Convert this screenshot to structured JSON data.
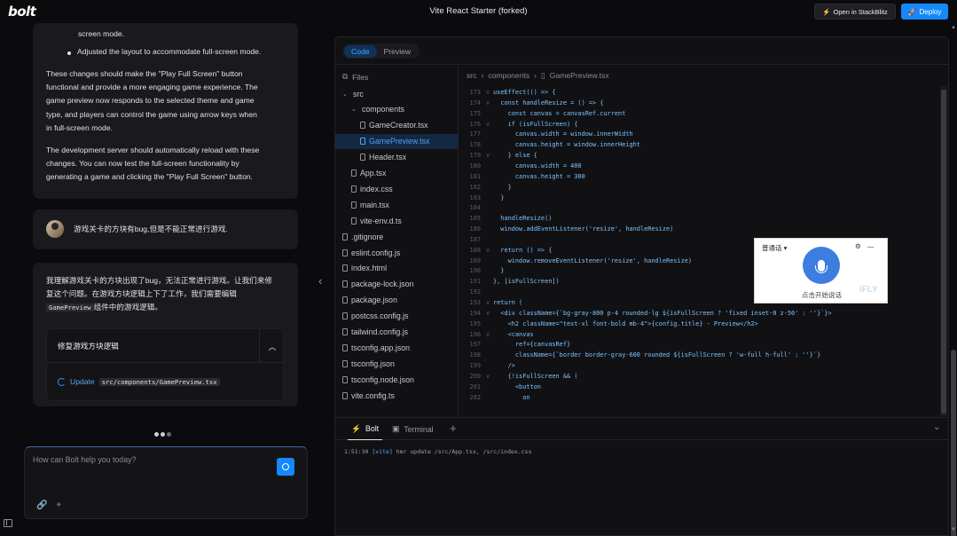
{
  "topbar": {
    "logo": "bolt",
    "title": "Vite React Starter (forked)",
    "stackblitz_label": "Open in StackBlitz",
    "deploy_label": "Deploy"
  },
  "chat": {
    "first_card": {
      "bullet_0_tail": "screen mode.",
      "bullet_1": "Adjusted the layout to accommodate full-screen mode.",
      "para_1": [
        "These changes should make the \"Play Full Screen\" button",
        "functional and provide a more engaging game experience. The",
        "game preview now responds to the selected theme and game",
        "type, and players can control the game using arrow keys when",
        "in full-screen mode."
      ],
      "para_2": [
        "The development server should automatically reload with these",
        "changes. You can now test the full-screen functionality by",
        "generating a game and clicking the \"Play Full Screen\" button."
      ]
    },
    "user_message": "游戏关卡的方块有bug,但是不能正常进行游戏.",
    "reply": {
      "line_1": "我理解游戏关卡的方块出现了bug，无法正常进行游戏。让我们来修",
      "line_2": "复这个问题。在游戏方块逻辑上下了工作，我们需要编辑",
      "code_ref": "GamePreview",
      "line_3_tail": "组件中的游戏逻辑。"
    },
    "action": {
      "title": "修复游戏方块逻辑",
      "verb": "Update",
      "path": "src/components/GamePreview.tsx"
    },
    "input_placeholder": "How can Bolt help you today?"
  },
  "workbench": {
    "tabs": [
      "Code",
      "Preview"
    ],
    "active_tab": "Code",
    "files_label": "Files",
    "tree": [
      {
        "name": "src",
        "type": "folder",
        "depth": 0
      },
      {
        "name": "components",
        "type": "folder",
        "depth": 1
      },
      {
        "name": "GameCreator.tsx",
        "type": "file",
        "depth": 2
      },
      {
        "name": "GamePreview.tsx",
        "type": "file",
        "depth": 2,
        "active": true
      },
      {
        "name": "Header.tsx",
        "type": "file",
        "depth": 2
      },
      {
        "name": "App.tsx",
        "type": "file",
        "depth": 1
      },
      {
        "name": "index.css",
        "type": "file",
        "depth": 1
      },
      {
        "name": "main.tsx",
        "type": "file",
        "depth": 1
      },
      {
        "name": "vite-env.d.ts",
        "type": "file",
        "depth": 1
      },
      {
        "name": ".gitignore",
        "type": "file",
        "depth": 0
      },
      {
        "name": "eslint.config.js",
        "type": "file",
        "depth": 0
      },
      {
        "name": "index.html",
        "type": "file",
        "depth": 0
      },
      {
        "name": "package-lock.json",
        "type": "file",
        "depth": 0
      },
      {
        "name": "package.json",
        "type": "file",
        "depth": 0
      },
      {
        "name": "postcss.config.js",
        "type": "file",
        "depth": 0
      },
      {
        "name": "tailwind.config.js",
        "type": "file",
        "depth": 0
      },
      {
        "name": "tsconfig.app.json",
        "type": "file",
        "depth": 0
      },
      {
        "name": "tsconfig.json",
        "type": "file",
        "depth": 0
      },
      {
        "name": "tsconfig.node.json",
        "type": "file",
        "depth": 0
      },
      {
        "name": "vite.config.ts",
        "type": "file",
        "depth": 0
      }
    ],
    "breadcrumb": [
      "src",
      "components",
      "GamePreview.tsx"
    ],
    "code": [
      {
        "n": "173",
        "fold": "v",
        "text": "useEffect(() => {"
      },
      {
        "n": "174",
        "fold": "v",
        "text": "  const handleResize = () => {"
      },
      {
        "n": "175",
        "fold": "",
        "text": "    const canvas = canvasRef.current"
      },
      {
        "n": "176",
        "fold": "v",
        "text": "    if (isFullScreen) {"
      },
      {
        "n": "177",
        "fold": "",
        "text": "      canvas.width = window.innerWidth"
      },
      {
        "n": "178",
        "fold": "",
        "text": "      canvas.height = window.innerHeight"
      },
      {
        "n": "179",
        "fold": "v",
        "text": "    } else {"
      },
      {
        "n": "180",
        "fold": "",
        "text": "      canvas.width = 400"
      },
      {
        "n": "181",
        "fold": "",
        "text": "      canvas.height = 300"
      },
      {
        "n": "182",
        "fold": "",
        "text": "    }"
      },
      {
        "n": "183",
        "fold": "",
        "text": "  }"
      },
      {
        "n": "184",
        "fold": "",
        "text": ""
      },
      {
        "n": "185",
        "fold": "",
        "text": "  handleResize()"
      },
      {
        "n": "186",
        "fold": "",
        "text": "  window.addEventListener('resize', handleResize)"
      },
      {
        "n": "187",
        "fold": "",
        "text": ""
      },
      {
        "n": "188",
        "fold": "v",
        "text": "  return () => {"
      },
      {
        "n": "189",
        "fold": "",
        "text": "    window.removeEventListener('resize', handleResize)"
      },
      {
        "n": "190",
        "fold": "",
        "text": "  }"
      },
      {
        "n": "191",
        "fold": "",
        "text": "}, [isFullScreen])"
      },
      {
        "n": "192",
        "fold": "",
        "text": ""
      },
      {
        "n": "193",
        "fold": "v",
        "text": "return ("
      },
      {
        "n": "194",
        "fold": "v",
        "text": "  <div className={`bg-gray-800 p-4 rounded-lg ${isFullScreen ? 'fixed inset-0 z-50' : ''}`}>"
      },
      {
        "n": "195",
        "fold": "",
        "text": "    <h2 className=\"text-xl font-bold mb-4\">{config.title} - Preview</h2>"
      },
      {
        "n": "196",
        "fold": "v",
        "text": "    <canvas"
      },
      {
        "n": "197",
        "fold": "",
        "text": "      ref={canvasRef}"
      },
      {
        "n": "198",
        "fold": "",
        "text": "      className={`border border-gray-600 rounded ${isFullScreen ? 'w-full h-full' : ''}`}"
      },
      {
        "n": "199",
        "fold": "",
        "text": "    />"
      },
      {
        "n": "200",
        "fold": "v",
        "text": "    {!isFullScreen && ("
      },
      {
        "n": "201",
        "fold": "",
        "text": "      <button"
      },
      {
        "n": "202",
        "fold": "",
        "text": "        on"
      }
    ],
    "terminal_tabs": [
      "Bolt",
      "Terminal"
    ],
    "terminal_prefix": "1:51:30",
    "terminal_tag": "[vite]",
    "terminal_line": "hmr update /src/App.tsx, /src/index.css"
  },
  "voice_widget": {
    "label": "普通话",
    "hint": "点击开始说话",
    "brand": "iFLY"
  }
}
